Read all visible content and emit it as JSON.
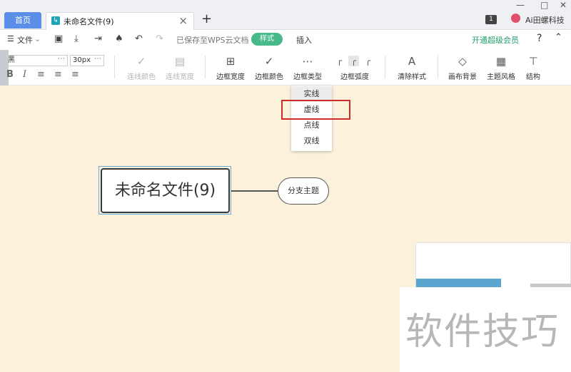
{
  "tabs": {
    "home_label": "首页",
    "doc_icon": "mindmap-icon",
    "doc_title": "未命名文件(9)",
    "close_icon": "×",
    "add_icon": "+"
  },
  "window": {
    "badge": "1",
    "account_name": "Ai田螺科技"
  },
  "menu": {
    "file_label": "文件",
    "saved_status": "已保存至WPS云文档",
    "style_tab": "样式",
    "insert_tab": "插入",
    "vip_label": "开通超级会员",
    "help_icon": "?"
  },
  "toolbar": {
    "font_name": "黑",
    "font_size": "30px",
    "tools": {
      "line_color": "连线颜色",
      "line_width": "连线宽度",
      "border_width": "边框宽度",
      "border_color": "边框颜色",
      "border_type": "边框类型",
      "border_radius": "边框弧度",
      "clear_style": "清除样式",
      "canvas_bg": "画布背景",
      "theme_style": "主题风格",
      "structure": "结构"
    }
  },
  "border_type_menu": {
    "options": [
      "实线",
      "虚线",
      "点线",
      "双线"
    ],
    "hovered": "实线",
    "highlighted": "虚线"
  },
  "mindmap": {
    "root_topic": "未命名文件(9)",
    "branch_topic": "分支主题"
  },
  "watermark_text": "软件技巧",
  "colors": {
    "canvas_bg": "#fcf2dc",
    "style_pill": "#47b98a",
    "vip_text": "#22a06b",
    "highlight_box": "#d12a2a",
    "home_tab": "#5b8ee6"
  }
}
